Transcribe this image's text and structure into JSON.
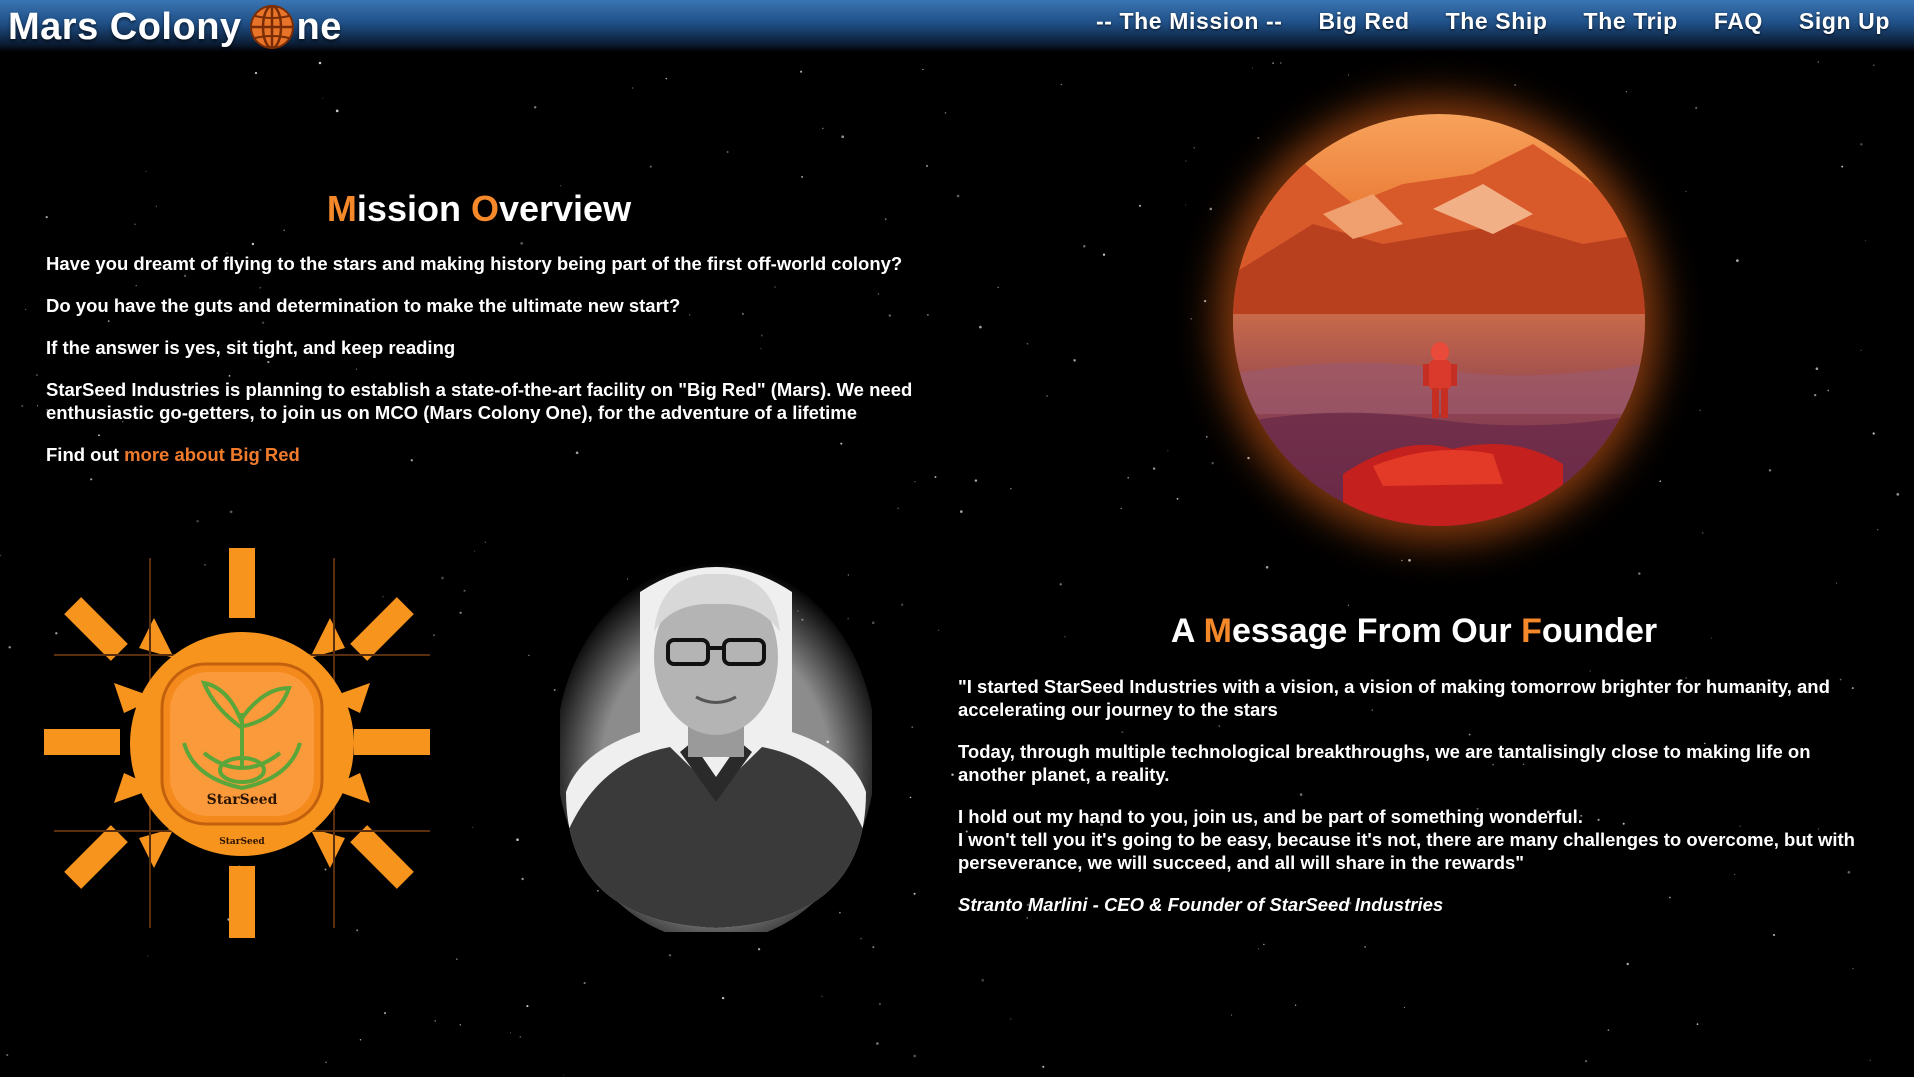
{
  "header": {
    "brand": {
      "before": "Mars Colony ",
      "after": "ne",
      "globe_icon": "globe-icon"
    },
    "nav": [
      {
        "label": "-- The Mission --"
      },
      {
        "label": "Big Red"
      },
      {
        "label": "The Ship"
      },
      {
        "label": "The Trip"
      },
      {
        "label": "FAQ"
      },
      {
        "label": "Sign Up"
      }
    ]
  },
  "mission": {
    "title_first": "M",
    "title_mid": "ission ",
    "title_second": "O",
    "title_end": "verview",
    "paragraphs": [
      "Have you dreamt of flying to the stars and making history being part of the first off-world colony?",
      "Do you have the guts and determination to make the ultimate new start?",
      "If the answer is yes, sit tight, and keep reading",
      "StarSeed Industries is planning to establish a state-of-the-art facility on \"Big Red\" (Mars). We need enthusiastic go-getters, to join us on MCO (Mars Colony One), for the adventure of a lifetime"
    ],
    "find_out_prefix": "Find out ",
    "find_out_link": "more about Big Red"
  },
  "logo": {
    "text": "StarSeed",
    "subtext": "StarSeed"
  },
  "founder": {
    "title_a": "A ",
    "title_m": "M",
    "title_mid": "essage From Our ",
    "title_f": "F",
    "title_end": "ounder",
    "paragraphs": [
      "\"I started StarSeed Industries with a vision, a vision of making tomorrow brighter for humanity, and accelerating our journey to the stars",
      "Today, through multiple technological breakthroughs, we are tantalisingly close to making life on another planet, a reality.",
      "I hold out my hand to you, join us, and be part of something wonderful.",
      "I won't tell you it's going to be easy, because it's not, there are many challenges to overcome, but with perseverance, we will succeed, and all will share in the rewards\""
    ],
    "signature": "Stranto Marlini - CEO & Founder of StarSeed Industries"
  },
  "colors": {
    "accent": "#f5892a",
    "link": "#f07b2c",
    "header_top": "#3a75b4",
    "background": "#000000"
  }
}
